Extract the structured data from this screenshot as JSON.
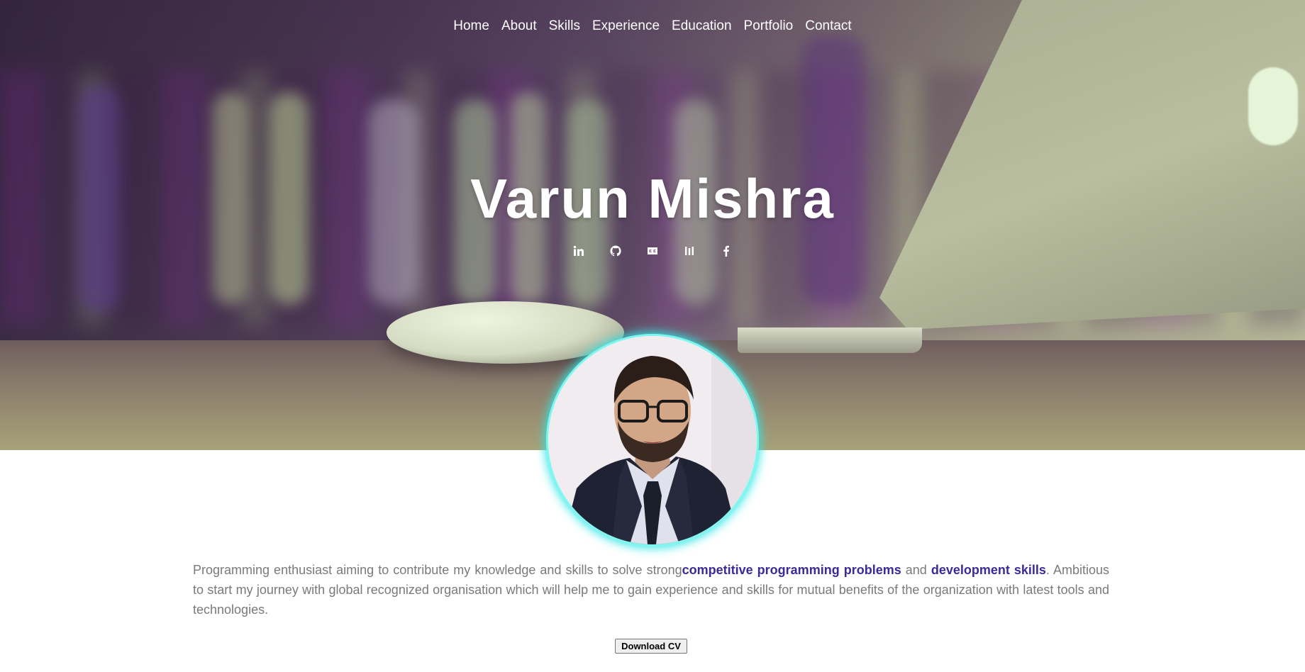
{
  "nav": {
    "items": [
      {
        "label": "Home"
      },
      {
        "label": "About"
      },
      {
        "label": "Skills"
      },
      {
        "label": "Experience"
      },
      {
        "label": "Education"
      },
      {
        "label": "Portfolio"
      },
      {
        "label": "Contact"
      }
    ]
  },
  "hero": {
    "name": "Varun Mishra",
    "social": [
      {
        "icon": "linkedin-icon"
      },
      {
        "icon": "github-icon"
      },
      {
        "icon": "codechef-icon"
      },
      {
        "icon": "hackerrank-icon"
      },
      {
        "icon": "facebook-icon"
      }
    ]
  },
  "about": {
    "text_1": "Programming enthusiast aiming to contribute my knowledge and skills to solve strong",
    "highlight_1": "competitive programming problems",
    "text_2": " and ",
    "highlight_2": "development skills",
    "text_3": ". Ambitious to start my journey with global recognized organisation which will help me to gain experience and skills for mutual benefits of the organization with latest tools and technologies."
  },
  "actions": {
    "download_cv": "Download CV"
  },
  "colors": {
    "highlight": "#3b2a9a",
    "avatar_ring": "#2ee6e6",
    "body_text": "#7a7a7a"
  }
}
